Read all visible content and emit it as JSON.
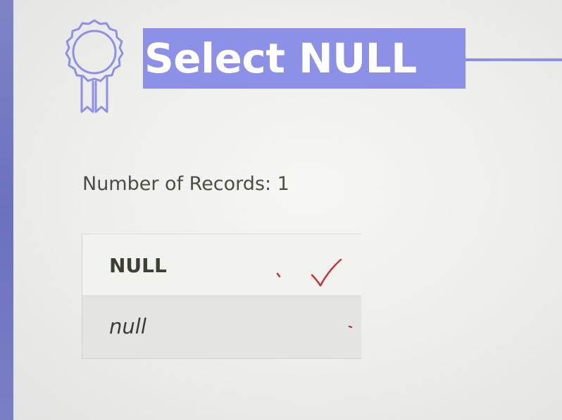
{
  "header": {
    "title": "Select NULL",
    "icon": "award-badge-icon",
    "accent_color": "#8c90e6"
  },
  "summary": {
    "record_count_text": "Number of Records: 1"
  },
  "result_table": {
    "columns": [
      "NULL"
    ],
    "rows": [
      [
        "null"
      ]
    ]
  },
  "annotations": {
    "checkmark": "checkmark-icon",
    "ink_color": "#c8323a"
  }
}
